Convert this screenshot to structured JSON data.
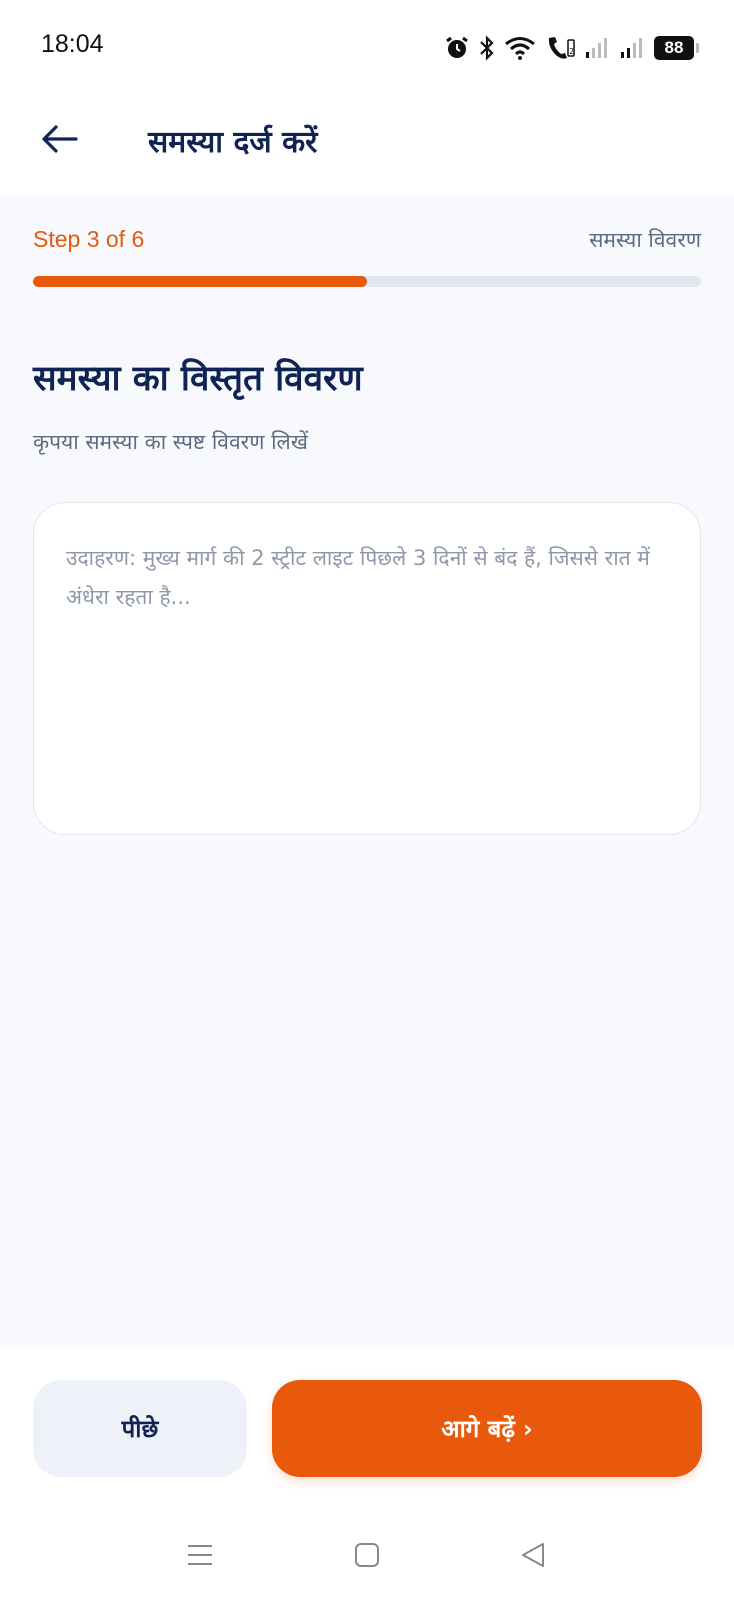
{
  "status_bar": {
    "time": "18:04",
    "battery": "88",
    "icons": [
      "alarm-icon",
      "bluetooth-icon",
      "wifi-icon",
      "wifi-call-icon",
      "signal-icon-1",
      "signal-icon-2",
      "battery-icon"
    ]
  },
  "header": {
    "title": "समस्या दर्ज करें",
    "back_icon": "arrow-left-icon"
  },
  "progress": {
    "step_label": "Step 3 of 6",
    "step_name": "समस्या विवरण",
    "current_step": 3,
    "total_steps": 6,
    "fraction": 0.5
  },
  "content": {
    "title": "समस्या का विस्तृत विवरण",
    "subtitle": "कृपया समस्या का स्पष्ट विवरण लिखें",
    "description_value": "",
    "description_placeholder": "उदाहरण: मुख्य मार्ग की 2 स्ट्रीट लाइट पिछले 3 दिनों से बंद हैं, जिससे रात में अंधेरा रहता है..."
  },
  "footer": {
    "back_label": "पीछे",
    "next_label": "आगे बढ़ें",
    "next_chevron": "›"
  },
  "colors": {
    "accent": "#e8590c",
    "primary_text": "#0f2454",
    "muted_text": "#5d6b82",
    "background": "#f7f9fc"
  },
  "system_nav": {
    "icons": [
      "menu-icon",
      "home-icon",
      "back-triangle-icon"
    ]
  }
}
